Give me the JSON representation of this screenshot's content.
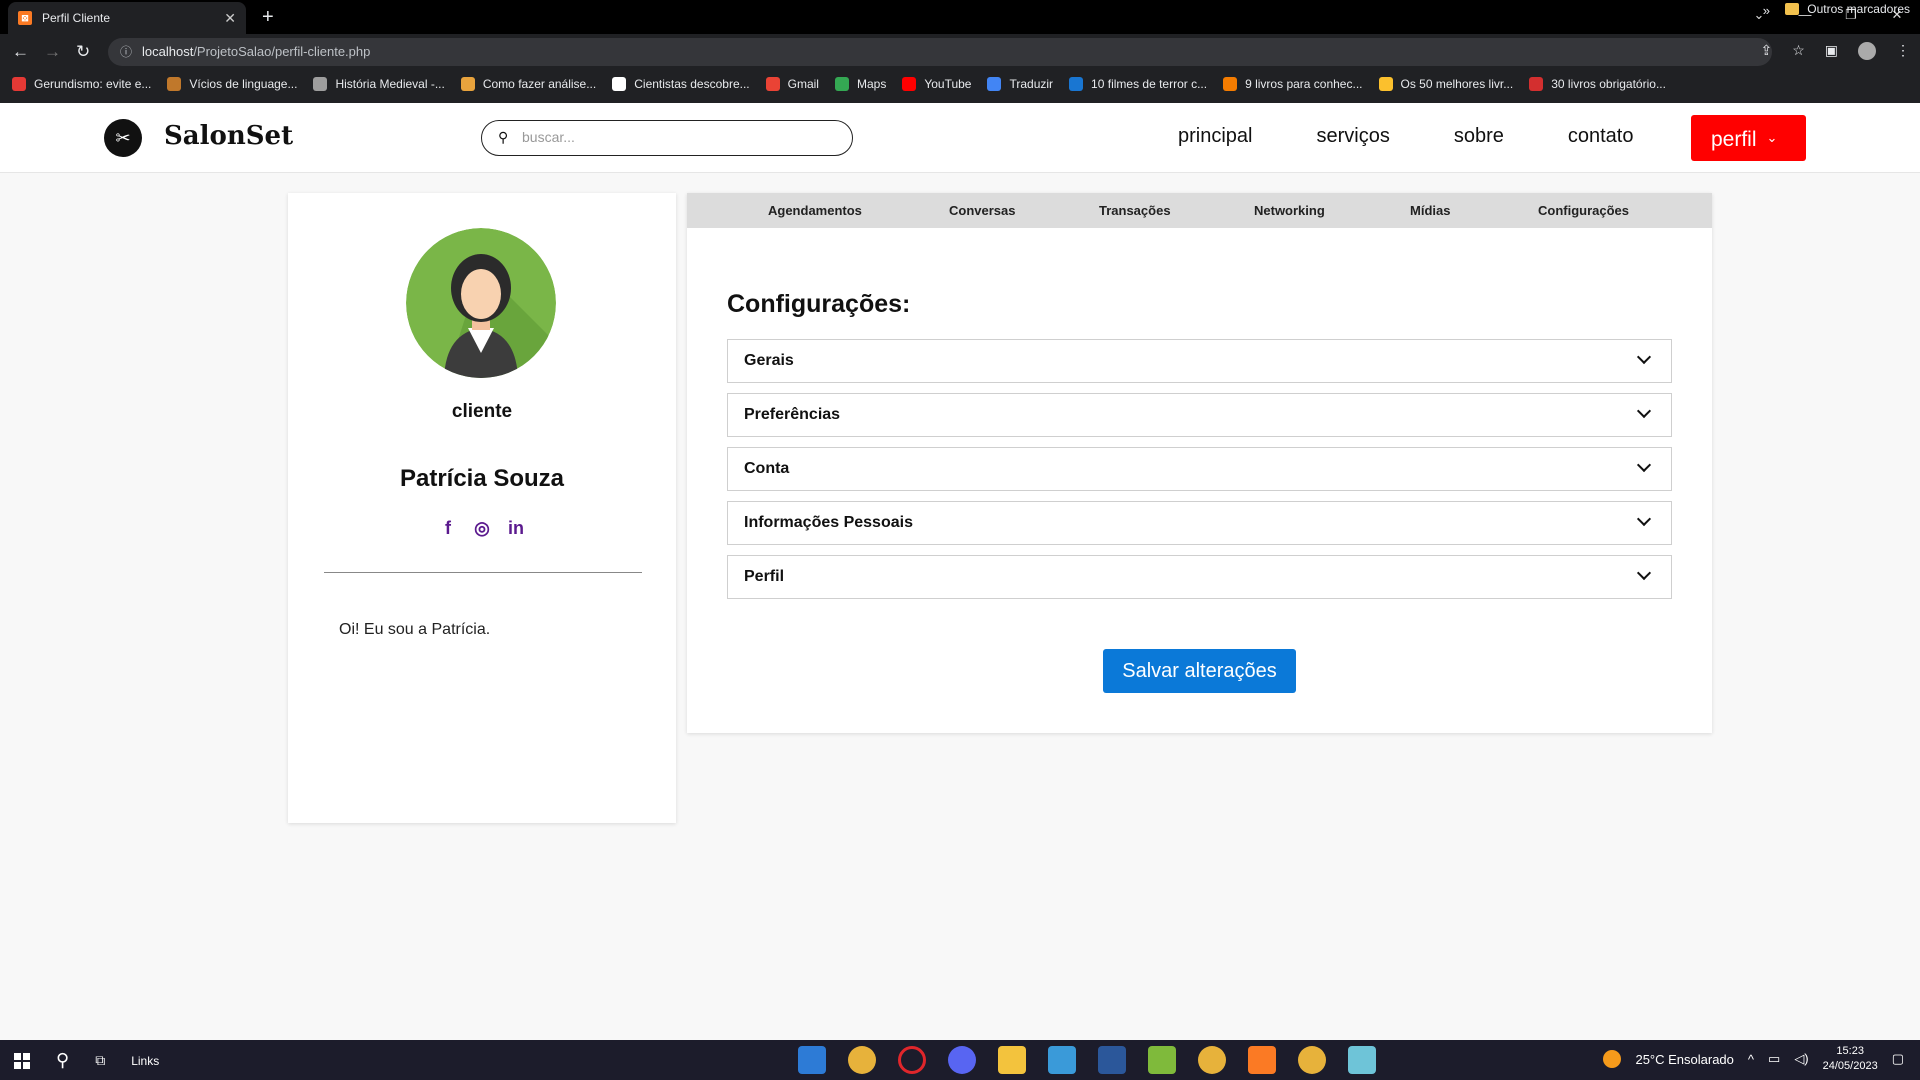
{
  "browser": {
    "tab_title": "Perfil Cliente",
    "tab_favicon": "XAMPP",
    "url_host": "localhost",
    "url_path": "/ProjetoSalao/perfil-cliente.php",
    "bookmarks": [
      {
        "label": "Gerundismo: evite e...",
        "color": "#e53935"
      },
      {
        "label": "Vícios de linguage...",
        "color": "#c0782b"
      },
      {
        "label": "História Medieval -...",
        "color": "#9e9e9e"
      },
      {
        "label": "Como fazer análise...",
        "color": "#e8a33d"
      },
      {
        "label": "Cientistas descobre...",
        "color": "#ffffff"
      },
      {
        "label": "Gmail",
        "color": "#ea4335"
      },
      {
        "label": "Maps",
        "color": "#34a853"
      },
      {
        "label": "YouTube",
        "color": "#ff0000"
      },
      {
        "label": "Traduzir",
        "color": "#4285f4"
      },
      {
        "label": "10 filmes de terror c...",
        "color": "#1976d2"
      },
      {
        "label": "9 livros para conhec...",
        "color": "#f57c00"
      },
      {
        "label": "Os 50 melhores livr...",
        "color": "#fbc02d"
      },
      {
        "label": "30 livros obrigatório...",
        "color": "#d32f2f"
      }
    ],
    "bookmarks_more": "»",
    "other_bookmarks": "Outros marcadores"
  },
  "site": {
    "brand": "SalonSet",
    "search_placeholder": "buscar...",
    "nav": [
      "principal",
      "serviços",
      "sobre",
      "contato"
    ],
    "profile_button": "perfil",
    "accent_color": "#ff0000"
  },
  "profile": {
    "role": "cliente",
    "name": "Patrícia Souza",
    "socials": [
      "facebook-icon",
      "instagram-icon",
      "linkedin-icon"
    ],
    "bio": "Oi! Eu sou a Patrícia."
  },
  "panel": {
    "tabs": [
      "Agendamentos",
      "Conversas",
      "Transações",
      "Networking",
      "Mídias",
      "Configurações"
    ],
    "title": "Configurações:",
    "sections": [
      "Gerais",
      "Preferências",
      "Conta",
      "Informações Pessoais",
      "Perfil"
    ],
    "save_label": "Salvar alterações",
    "save_color": "#0b79d8"
  },
  "taskbar": {
    "search_label": "Links",
    "weather": "25°C  Ensolarado",
    "time": "15:23",
    "date": "24/05/2023"
  }
}
